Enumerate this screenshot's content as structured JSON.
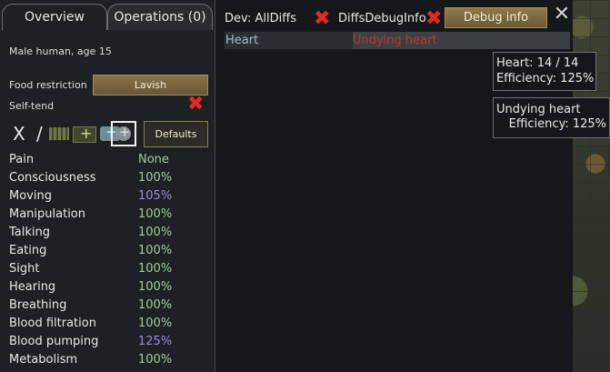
{
  "tabs": {
    "overview": "Overview",
    "operations": "Operations (0)"
  },
  "pawn": {
    "description": "Male human, age 15"
  },
  "food_restriction": {
    "label": "Food restriction",
    "value": "Lavish"
  },
  "self_tend": {
    "label": "Self-tend",
    "state_icon": "x-icon"
  },
  "care_buttons": {
    "defaults_label": "Defaults",
    "icons": [
      "no-care-icon",
      "no-meds-icon",
      "herbal-medicine-icon",
      "industrial-medicine-icon",
      "ultratech-medicine-icon",
      "best-medicine-icon"
    ],
    "selected_index": 5
  },
  "capacities": [
    {
      "name": "Pain",
      "value": "None"
    },
    {
      "name": "Consciousness",
      "value": "100%"
    },
    {
      "name": "Moving",
      "value": "105%"
    },
    {
      "name": "Manipulation",
      "value": "100%"
    },
    {
      "name": "Talking",
      "value": "100%"
    },
    {
      "name": "Eating",
      "value": "100%"
    },
    {
      "name": "Sight",
      "value": "100%"
    },
    {
      "name": "Hearing",
      "value": "100%"
    },
    {
      "name": "Breathing",
      "value": "100%"
    },
    {
      "name": "Blood filtration",
      "value": "100%"
    },
    {
      "name": "Blood pumping",
      "value": "125%"
    },
    {
      "name": "Metabolism",
      "value": "100%"
    }
  ],
  "dev": {
    "all_diffs": "Dev: AllDiffs",
    "diffs_debug": "DiffsDebugInfo",
    "debug_info": "Debug info"
  },
  "hediff_row": {
    "part": "Heart",
    "hediff": "Undying heart"
  },
  "tooltips": {
    "heart_line": "Heart:  14 / 14",
    "efficiency_line": "Efficiency: 125%",
    "undying_title": "Undying heart",
    "undying_efficiency": "Efficiency: 125%"
  },
  "colors": {
    "normal_value": "#a6c99f",
    "boosted_value": "#9c89e0",
    "hediff_red": "#c63322",
    "cross_red": "#e02b20"
  }
}
